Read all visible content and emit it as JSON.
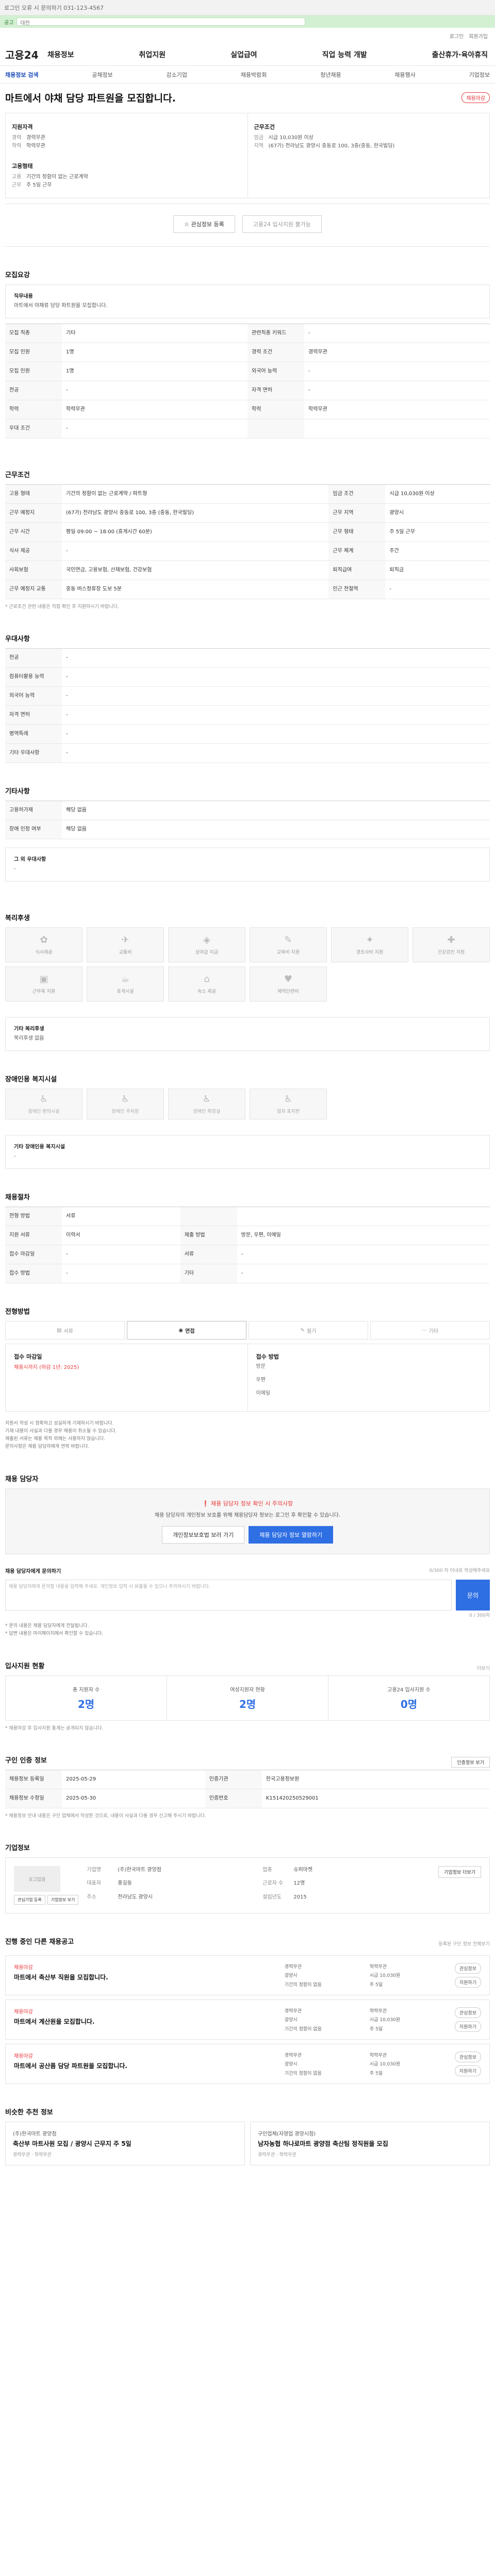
{
  "topbar": {
    "notice": "로그인 오류 시 문의하기 031-123-4567"
  },
  "greenbar": {
    "badge": "공고",
    "query": "대전"
  },
  "mini": {
    "links": [
      "로그인",
      "회원가입"
    ]
  },
  "gnb": {
    "logo": "고용24",
    "menu": [
      "채용정보",
      "취업지원",
      "실업급여",
      "직업 능력 개발",
      "출산휴가·육아휴직"
    ]
  },
  "subnav": {
    "items": [
      "채용정보 검색",
      "공채정보",
      "강소기업",
      "채용박람회",
      "청년채용",
      "채용행사",
      "기업정보"
    ]
  },
  "title": {
    "text": "마트에서 야채 담당 파트원을 모집합니다.",
    "badge": "채용마감"
  },
  "summary": {
    "left_head": "지원자격",
    "left_rows": [
      {
        "k": "경력",
        "v": "경력무관"
      },
      {
        "k": "학력",
        "v": "학력무관"
      }
    ],
    "left_head2": "고용형태",
    "left_rows2": [
      {
        "k": "고용",
        "v": "기간의 정함이 없는 근로계약"
      },
      {
        "k": "근무",
        "v": "주 5일 근무"
      }
    ],
    "right_head": "근무조건",
    "right_rows": [
      {
        "k": "임금",
        "v": "시급 10,030원 이상"
      },
      {
        "k": "지역",
        "v": "(67가) 전라남도 광양시 중동로 100, 3층(중동, 한국빌딩)"
      }
    ],
    "btn_interest": "관심정보 등록",
    "btn_apply": "고용24 입사지원 불가능"
  },
  "recruit": {
    "title": "모집요강",
    "duty_head": "직무내용",
    "duty": "마트에서 야채류 담당 파트원을 모집합니다.",
    "rows": [
      {
        "k": "모집 직종",
        "v": "기타",
        "k2": "관련직종 키워드",
        "v2": "-"
      },
      {
        "k": "모집 인원",
        "v": "1명",
        "k2": "경력 조건",
        "v2": "경력무관"
      },
      {
        "k": "모집 인원",
        "v": "1명",
        "k2": "외국어 능력",
        "v2": "-"
      },
      {
        "k": "전공",
        "v": "-",
        "k2": "자격 면허",
        "v2": "-"
      },
      {
        "k": "학력",
        "v": "학력무관",
        "k2": "학력",
        "v2": "학력무관"
      },
      {
        "k": "우대 조건",
        "v": "-",
        "k2": "",
        "v2": ""
      }
    ]
  },
  "work": {
    "title": "근무조건",
    "rows": [
      {
        "k": "고용 형태",
        "v": "기간의 정함이 없는 근로계약 / 파트형",
        "k2": "임금 조건",
        "v2": "시급 10,030원 이상"
      },
      {
        "k": "근무 예정지",
        "v": "(67가) 전라남도 광양시 중동로 100, 3층 (중동, 한국빌딩)",
        "k2": "근무 지역",
        "v2": "광양시"
      },
      {
        "k": "근무 시간",
        "v": "평일 09:00 ~ 18:00 (휴게시간 60분)",
        "k2": "근무 형태",
        "v2": "주 5일 근무"
      },
      {
        "k": "식사 제공",
        "v": "-",
        "k2": "근무 체계",
        "v2": "주간"
      },
      {
        "k": "사회보험",
        "v": "국민연금, 고용보험, 산재보험, 건강보험",
        "k2": "퇴직급여",
        "v2": "퇴직금"
      },
      {
        "k": "근무 예정지 교통",
        "v": "중동 버스정류장 도보 5분",
        "k2": "인근 전철역",
        "v2": "-"
      }
    ],
    "note": "* 근로조건 관련 내용은 직접 확인 후 지원하시기 바랍니다."
  },
  "prefer": {
    "title": "우대사항",
    "rows": [
      {
        "k": "전공",
        "v": "-"
      },
      {
        "k": "컴퓨터활용 능력",
        "v": "-"
      },
      {
        "k": "외국어 능력",
        "v": "-"
      },
      {
        "k": "자격 면허",
        "v": "-"
      },
      {
        "k": "병역특례",
        "v": "-"
      },
      {
        "k": "기타 우대사항",
        "v": "-"
      }
    ]
  },
  "etc": {
    "title": "기타사항",
    "rows": [
      {
        "k": "고용허가제",
        "v": "해당 없음"
      },
      {
        "k": "장애 인정 여부",
        "v": "해당 없음"
      }
    ],
    "extra_head": "그 외 우대사항",
    "extra": "-"
  },
  "welfare": {
    "title": "복리후생",
    "items": [
      "식사제공",
      "교통비",
      "상여금 지급",
      "교육비 지원",
      "경조사비 지원",
      "건강검진 지원",
      "근무복 지원",
      "휴게시설",
      "숙소 제공",
      "체력단련비",
      "",
      ""
    ],
    "note_head": "기타 복리후생",
    "note": "복리후생 없음"
  },
  "disab": {
    "title": "장애인용 복지시설",
    "items": [
      "장애인 편의시설",
      "장애인 주차장",
      "장애인 화장실",
      "점자 표지판",
      "",
      ""
    ],
    "note_head": "기타 장애인용 복지시설",
    "note": "-"
  },
  "flow": {
    "title": "채용절차",
    "rows": [
      {
        "k": "전형 방법",
        "v": "서류",
        "k2": "",
        "v2": ""
      },
      {
        "k": "지원 서류",
        "v": "이력서",
        "k2": "제출 방법",
        "v2": "방문, 우편, 이메일"
      },
      {
        "k": "접수 마감일",
        "v": "-",
        "k2": "서류",
        "v2": "-"
      },
      {
        "k": "접수 방법",
        "v": "-",
        "k2": "기타",
        "v2": "-"
      }
    ]
  },
  "apply_method": {
    "title": "전형방법",
    "steps": [
      "서류",
      "면접",
      "필기",
      "기타"
    ],
    "left_head": "접수 마감일",
    "left_red": "채용시까지 (마감 1년: 2025)",
    "right_head": "접수 방법",
    "right_rows": [
      "방문",
      "우편",
      "이메일"
    ],
    "bullets": [
      "지원서 작성 시 정확하고 성실하게 기재하시기 바랍니다.",
      "기재 내용이 사실과 다를 경우 채용이 취소될 수 있습니다.",
      "제출된 서류는 채용 목적 외에는 사용하지 않습니다.",
      "문의사항은 채용 담당자에게 연락 바랍니다."
    ]
  },
  "contact": {
    "title": "채용 담당자",
    "notice": "채용 담당자 정보 확인 시 주의사항",
    "desc": "채용 담당자의 개인정보 보호를 위해 채용담당자 정보는 로그인 후 확인할 수 있습니다.",
    "btn1": "개인정보보호법 보러 가기",
    "btn2": "채용 담당자 정보 열람하기",
    "q_title": "채용 담당자에게 문의하기",
    "q_hint": "0/300 자 이내로 작성해주세요",
    "q_placeholder": "채용 담당자에게 문의할 내용을 입력해 주세요. 개인정보 입력 시 유출될 수 있으니 주의하시기 바랍니다.",
    "q_count": "0 / 300자",
    "q_submit": "문의",
    "q_notes": [
      "* 문의 내용은 채용 담당자에게 전달됩니다.",
      "* 답변 내용은 마이페이지에서 확인할 수 있습니다."
    ]
  },
  "stats": {
    "title": "입사지원 현황",
    "more": "더보기",
    "items": [
      {
        "l": "총 지원자 수",
        "n": "2명"
      },
      {
        "l": "여성지원자 현황",
        "n": "2명"
      },
      {
        "l": "고용24 입사지원 수",
        "n": "0명"
      }
    ],
    "note": "* 채용마감 후 입사지원 통계는 공개되지 않습니다."
  },
  "reg": {
    "title": "구인 인증 정보",
    "more": "인증정보 보기",
    "rows": [
      {
        "k": "채용정보 등록일",
        "v": "2025-05-29",
        "k2": "인증기관",
        "v2": "한국고용정보원"
      },
      {
        "k": "채용정보 수정일",
        "v": "2025-05-30",
        "k2": "인증번호",
        "v2": "K151420250529001"
      }
    ],
    "note": "* 채용정보 안내 내용은 구인 업체에서 작성한 것으로, 내용이 사실과 다를 경우 신고해 주시기 바랍니다."
  },
  "corp": {
    "title": "기업정보",
    "logo": "로고없음",
    "btn_follow": "관심기업 등록",
    "btn_more": "기업정보 보기",
    "rows": [
      {
        "k": "기업명",
        "v": "(주)한국마트 광양점"
      },
      {
        "k": "업종",
        "v": "슈퍼마켓"
      },
      {
        "k": "대표자",
        "v": "홍길동"
      },
      {
        "k": "근로자 수",
        "v": "12명"
      },
      {
        "k": "주소",
        "v": "전라남도 광양시"
      },
      {
        "k": "설립년도",
        "v": "2015"
      }
    ],
    "btn_detail": "기업정보 더보기"
  },
  "related": {
    "title": "진행 중인 다른 채용공고",
    "more": "등록된 구인 정보 전체보기",
    "items": [
      {
        "co": "채용마감",
        "title": "마트에서 축산부 직원을 모집합니다.",
        "r": [
          "경력무관",
          "학력무관",
          "광양시",
          "시급 10,030원",
          "기간의 정함이 없음",
          "주 5일"
        ],
        "b1": "관심정보",
        "b2": "지원하기"
      },
      {
        "co": "채용마감",
        "title": "마트에서 계산원을 모집합니다.",
        "r": [
          "경력무관",
          "학력무관",
          "광양시",
          "시급 10,030원",
          "기간의 정함이 없음",
          "주 5일"
        ],
        "b1": "관심정보",
        "b2": "지원하기"
      },
      {
        "co": "채용마감",
        "title": "마트에서 공산품 담당 파트원을 모집합니다.",
        "r": [
          "경력무관",
          "학력무관",
          "광양시",
          "시급 10,030원",
          "기간의 정함이 없음",
          "주 5일"
        ],
        "b1": "관심정보",
        "b2": "지원하기"
      }
    ]
  },
  "recommend": {
    "title": "비슷한 추천 정보",
    "items": [
      {
        "co": "(주)한국마트 광양점",
        "title": "축산부 마트사원 모집 / 광양시 근무지 주 5일",
        "r": [
          "경력무관",
          "학력무관"
        ]
      },
      {
        "co": "구인업체(자영업 광양시점)",
        "title": "남자농협 하나로마트 광양점 축산팀 정직원을 모집",
        "r": [
          "경력무관",
          "학력무관"
        ]
      }
    ]
  }
}
